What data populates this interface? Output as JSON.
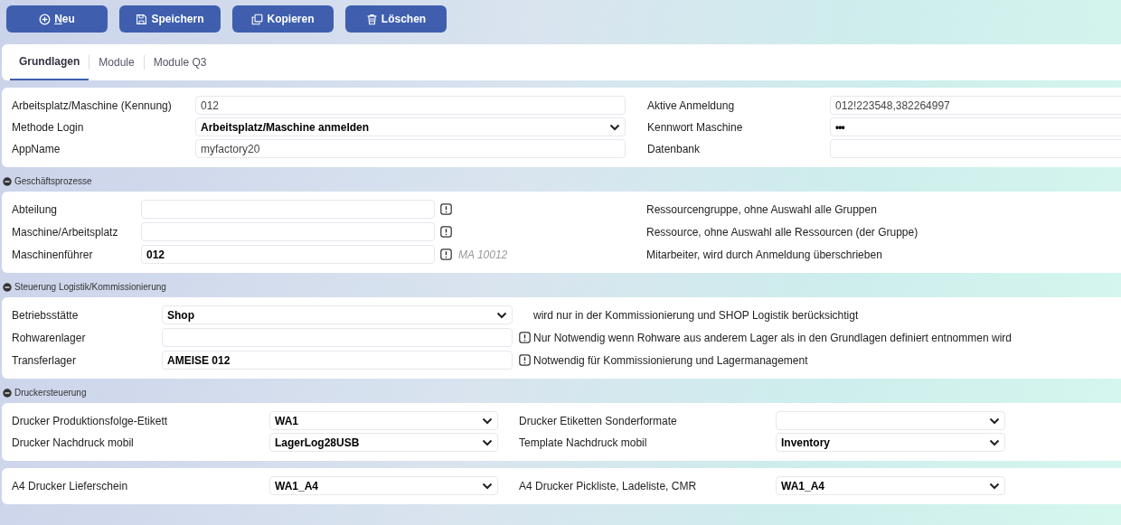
{
  "toolbar": [
    {
      "label": "Neu",
      "kind": "plus",
      "access_key_first": true
    },
    {
      "label": "Speichern",
      "kind": "save",
      "access_key_first": false
    },
    {
      "label": "Kopieren",
      "kind": "copy",
      "access_key_first": false
    },
    {
      "label": "Löschen",
      "kind": "trash",
      "access_key_first": false
    }
  ],
  "tabs": [
    {
      "label": "Grundlagen",
      "selected": true
    },
    {
      "label": "Module",
      "selected": false
    },
    {
      "label": "Module Q3",
      "selected": false
    }
  ],
  "sections": [
    {
      "kind": "pairs-wide",
      "rows": [
        {
          "left": {
            "label": "Arbeitsplatz/Maschine (Kennung)",
            "field": {
              "kind": "text",
              "value": "012",
              "readonly": true
            }
          },
          "right": {
            "label": "Aktive Anmeldung",
            "field": {
              "kind": "text",
              "value": "012!223548,382264997",
              "readonly": true
            }
          }
        },
        {
          "left": {
            "label": "Methode Login",
            "field": {
              "kind": "select",
              "value": "Arbeitsplatz/Maschine anmelden"
            }
          },
          "right": {
            "label": "Kennwort Maschine",
            "field": {
              "kind": "password",
              "value": "•••"
            }
          }
        },
        {
          "left": {
            "label": "AppName",
            "field": {
              "kind": "text",
              "value": "myfactory20",
              "readonly": true
            }
          },
          "right": {
            "label": "Datenbank",
            "field": {
              "kind": "text"
            }
          }
        }
      ]
    },
    {
      "kind": "notes-narrow",
      "title": "Geschäftsprozesse",
      "expanded": true,
      "rows": [
        {
          "label": "Abteilung",
          "field": {
            "kind": "text"
          },
          "info_icon": true,
          "description": "Ressourcengruppe, ohne Auswahl alle Gruppen"
        },
        {
          "label": "Maschine/Arbeitsplatz",
          "field": {
            "kind": "text"
          },
          "info_icon": true,
          "description": "Ressource, ohne Auswahl alle Ressourcen (der Gruppe)"
        },
        {
          "label": "Maschinenführer",
          "field": {
            "kind": "text",
            "value": "012",
            "readonly": false
          },
          "info_icon": true,
          "hint": "MA 10012",
          "description": "Mitarbeiter, wird durch Anmeldung überschrieben"
        }
      ]
    },
    {
      "kind": "notes-wide",
      "title": "Steuerung Logistik/Kommissionierung",
      "expanded": true,
      "rows": [
        {
          "label": "Betriebsstätte",
          "field": {
            "kind": "select",
            "value": "Shop"
          },
          "info_icon": false,
          "description": "wird nur in der Kommissionierung und SHOP Logistik berücksichtigt"
        },
        {
          "label": "Rohwarenlager",
          "field": {
            "kind": "text"
          },
          "info_icon": true,
          "description": "Nur Notwendig wenn Rohware aus anderem Lager als in den Grundlagen definiert entnommen wird"
        },
        {
          "label": "Transferlager",
          "field": {
            "kind": "text",
            "value": "AMEISE 012",
            "readonly": false
          },
          "info_icon": true,
          "description": "Notwendig für Kommissionierung und Lagermanagement"
        }
      ]
    },
    {
      "kind": "pairs-narrow",
      "title": "Druckersteuerung",
      "expanded": true,
      "rows": [
        {
          "left": {
            "label": "Drucker Produktionsfolge-Etikett",
            "field": {
              "kind": "select",
              "value": "WA1"
            }
          },
          "right": {
            "label": "Drucker Etiketten Sonderformate",
            "field": {
              "kind": "select"
            }
          }
        },
        {
          "left": {
            "label": "Drucker Nachdruck mobil",
            "field": {
              "kind": "select",
              "value": "LagerLog28USB"
            }
          },
          "right": {
            "label": "Template Nachdruck mobil",
            "field": {
              "kind": "select",
              "value": "Inventory"
            }
          }
        }
      ]
    },
    {
      "kind": "pairs-narrow",
      "rows": [
        {
          "left": {
            "label": "A4 Drucker Lieferschein",
            "field": {
              "kind": "select",
              "value": "WA1_A4"
            }
          },
          "right": {
            "label": "A4 Drucker Pickliste, Ladeliste, CMR",
            "field": {
              "kind": "select",
              "value": "WA1_A4"
            }
          }
        }
      ]
    }
  ]
}
